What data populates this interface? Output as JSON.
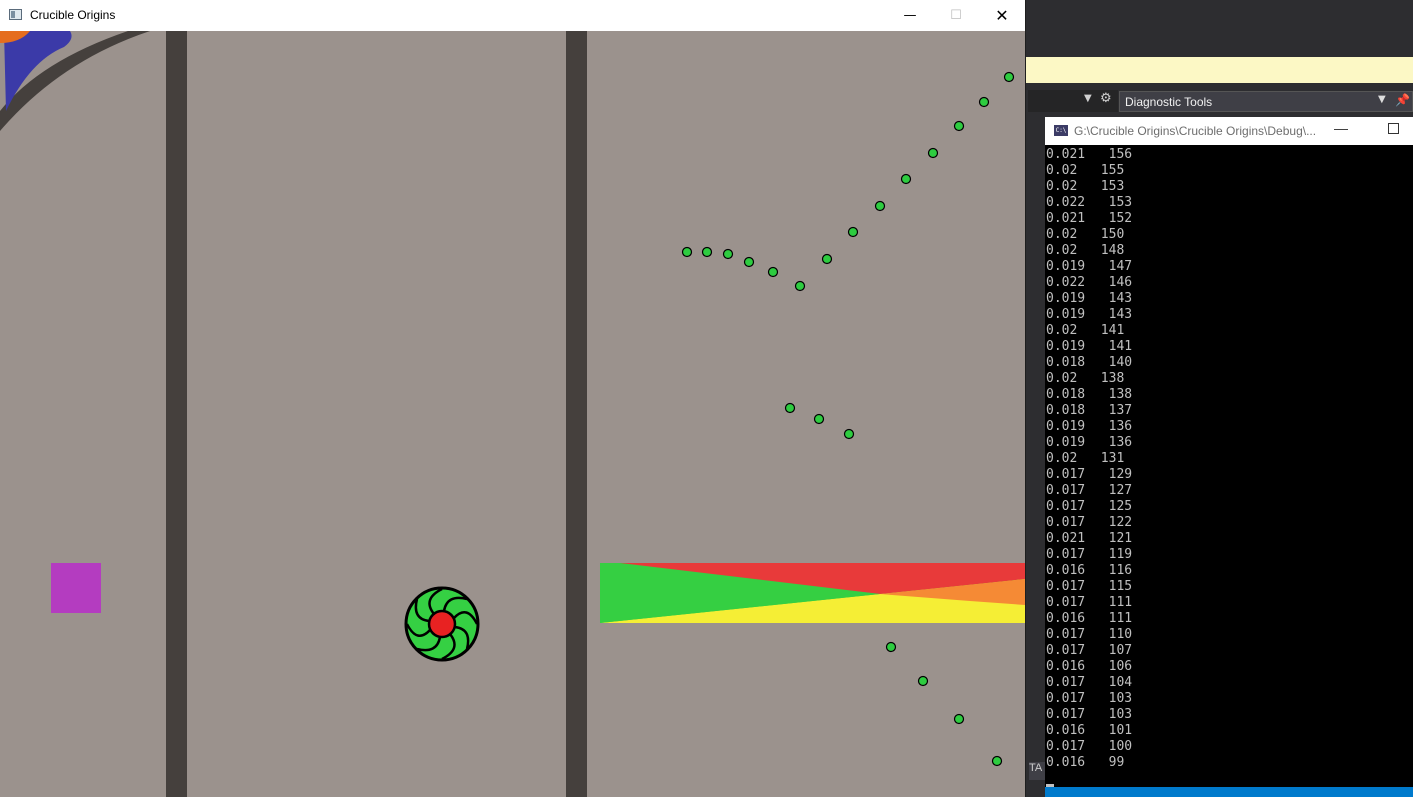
{
  "game": {
    "title": "Crucible Origins",
    "controls": {
      "minimize": "—",
      "maximize": "☐",
      "close": "✕"
    }
  },
  "ide": {
    "diagnostic_tools_label": "Diagnostic Tools",
    "console": {
      "icon_text": "C:\\",
      "path": "G:\\Crucible Origins\\Crucible Origins\\Debug\\...",
      "lines": [
        "0.021   156",
        "0.02   155",
        "0.02   153",
        "0.022   153",
        "0.021   152",
        "0.02   150",
        "0.02   148",
        "0.019   147",
        "0.022   146",
        "0.019   143",
        "0.019   143",
        "0.02   141",
        "0.019   141",
        "0.018   140",
        "0.02   138",
        "0.018   138",
        "0.018   137",
        "0.019   136",
        "0.019   136",
        "0.02   131",
        "0.017   129",
        "0.017   127",
        "0.017   125",
        "0.017   122",
        "0.021   121",
        "0.017   119",
        "0.016   116",
        "0.017   115",
        "0.017   111",
        "0.016   111",
        "0.017   110",
        "0.017   107",
        "0.016   106",
        "0.017   104",
        "0.017   103",
        "0.017   103",
        "0.016   101",
        "0.017   100",
        "0.016   99"
      ]
    },
    "ta_label": "TA"
  },
  "colors": {
    "floor": "#9b928d",
    "wall": "#45403d",
    "enemy_dot": "#2ecc40",
    "player_body": "#35d043",
    "player_core": "#e82222",
    "pickup": "#b43cc0",
    "gradient_green": "#35cf42",
    "gradient_red": "#e83a3a",
    "gradient_yellow": "#f5ee35",
    "gradient_orange": "#f58a35"
  }
}
